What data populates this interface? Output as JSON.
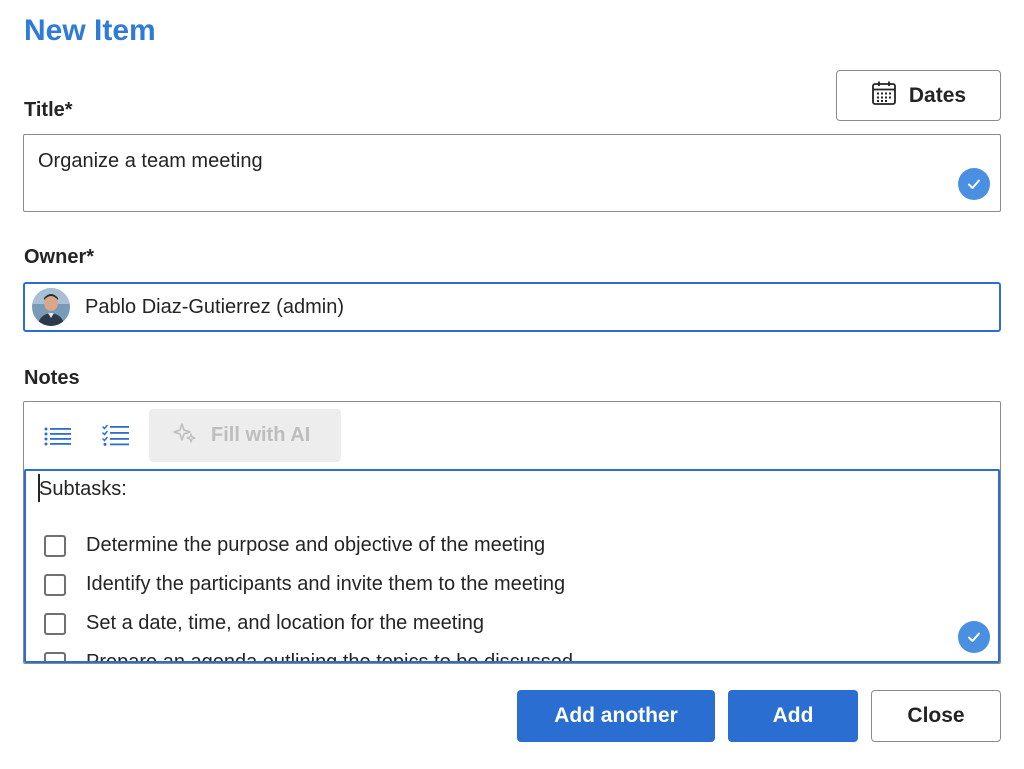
{
  "dialog": {
    "title": "New Item"
  },
  "dates_button": {
    "label": "Dates",
    "icon": "calendar-icon"
  },
  "title_field": {
    "label": "Title*",
    "value": "Organize a team meeting",
    "valid_icon": "checkmark-circle-icon"
  },
  "owner_field": {
    "label": "Owner*",
    "value": "Pablo Diaz-Gutierrez (admin)",
    "avatar": "user-avatar"
  },
  "notes": {
    "label": "Notes",
    "toolbar": {
      "bullet_list_icon": "bullet-list-icon",
      "checklist_icon": "checklist-icon",
      "fill_ai_label": "Fill with AI",
      "fill_ai_icon": "sparkle-icon"
    },
    "heading": "Subtasks:",
    "tasks": [
      {
        "text": "Determine the purpose and objective of the meeting",
        "checked": false
      },
      {
        "text": "Identify the participants and invite them to the meeting",
        "checked": false
      },
      {
        "text": "Set a date, time, and location for the meeting",
        "checked": false
      },
      {
        "text": "Prepare an agenda outlining the topics to be discussed",
        "checked": false
      }
    ]
  },
  "actions": {
    "add_another": "Add another",
    "add": "Add",
    "close": "Close"
  },
  "colors": {
    "accent": "#2b6ed2",
    "title_blue": "#2f7bd8",
    "check_badge": "#4a90e2",
    "disabled_bg": "#ededed",
    "disabled_text": "#bdbdbd"
  }
}
